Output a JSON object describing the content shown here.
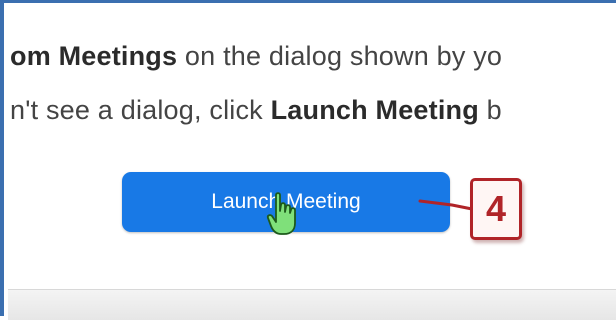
{
  "instruction": {
    "line1": {
      "bold_start": "om Meetings",
      "text_after": " on the dialog shown by yo"
    },
    "line2": {
      "text_before": "n't see a dialog, click ",
      "bold": "Launch Meeting",
      "text_after": " b"
    }
  },
  "launch_button": {
    "label": "Launch Meeting",
    "color": "#1879e6"
  },
  "cursor": {
    "icon": "hand-pointer-icon"
  },
  "callout": {
    "number": "4",
    "color": "#b02428"
  },
  "frame": {
    "border_color": "#3b6fb0"
  }
}
